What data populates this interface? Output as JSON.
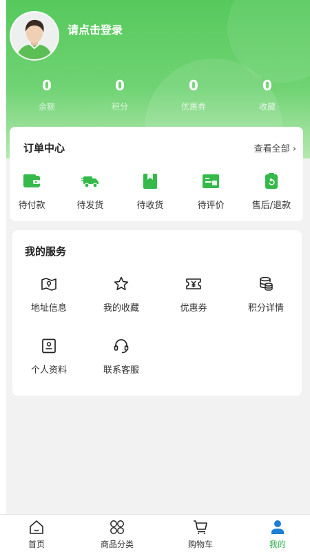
{
  "header": {
    "login_text": "请点击登录",
    "stats": [
      {
        "value": "0",
        "label": "余额"
      },
      {
        "value": "0",
        "label": "积分"
      },
      {
        "value": "0",
        "label": "优惠券"
      },
      {
        "value": "0",
        "label": "收藏"
      }
    ]
  },
  "orders": {
    "title": "订单中心",
    "view_all": "查看全部",
    "items": [
      {
        "label": "待付款",
        "icon": "wallet-icon"
      },
      {
        "label": "待发货",
        "icon": "truck-icon"
      },
      {
        "label": "待收货",
        "icon": "package-icon"
      },
      {
        "label": "待评价",
        "icon": "review-icon"
      },
      {
        "label": "售后/退款",
        "icon": "refund-icon"
      }
    ]
  },
  "services": {
    "title": "我的服务",
    "items": [
      {
        "label": "地址信息",
        "icon": "map-icon"
      },
      {
        "label": "我的收藏",
        "icon": "star-icon"
      },
      {
        "label": "优惠券",
        "icon": "coupon-icon"
      },
      {
        "label": "积分详情",
        "icon": "coins-icon"
      },
      {
        "label": "个人资料",
        "icon": "profile-icon"
      },
      {
        "label": "联系客服",
        "icon": "headset-icon"
      }
    ]
  },
  "tabbar": {
    "items": [
      {
        "label": "首页",
        "icon": "home-icon"
      },
      {
        "label": "商品分类",
        "icon": "category-icon"
      },
      {
        "label": "购物车",
        "icon": "cart-icon"
      },
      {
        "label": "我的",
        "icon": "user-icon"
      }
    ],
    "active_index": 3
  },
  "colors": {
    "accent": "#2fb34a",
    "header_green": "#56c95c"
  }
}
